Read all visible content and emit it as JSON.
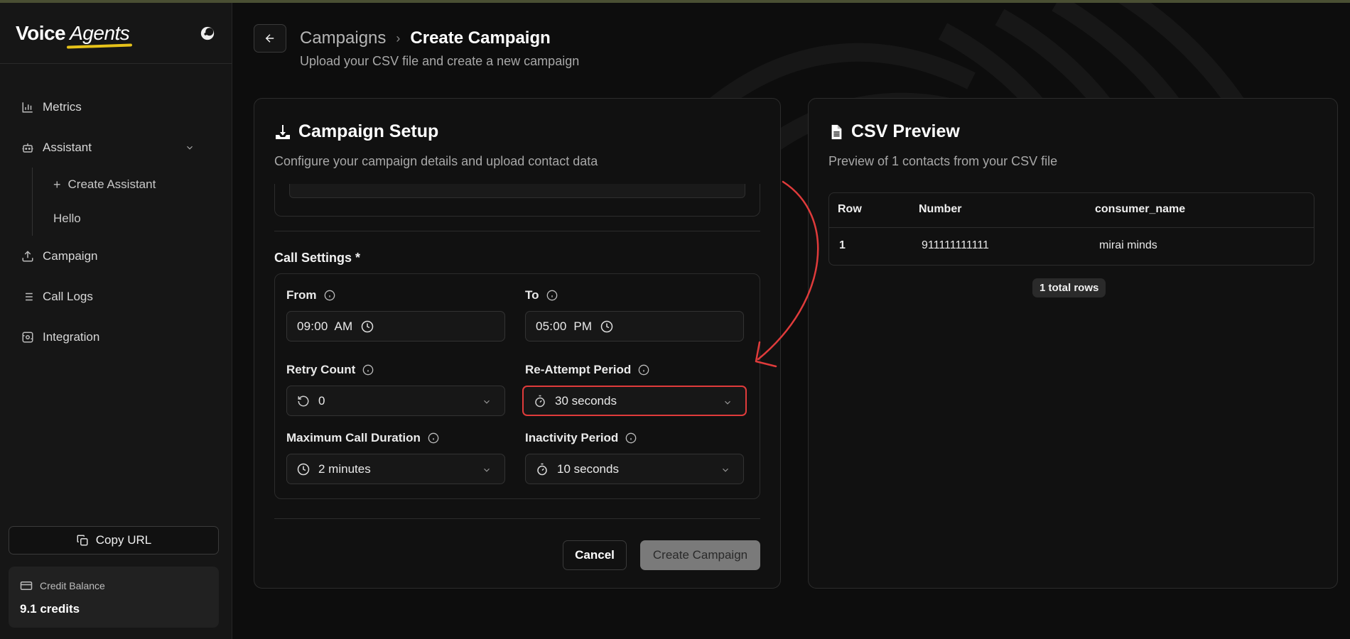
{
  "app": {
    "brand_main": "Voice",
    "brand_accent": "Agents"
  },
  "sidebar": {
    "items": [
      {
        "label": "Metrics",
        "icon": "bar-chart-icon"
      },
      {
        "label": "Assistant",
        "icon": "bot-icon"
      },
      {
        "label": "Campaign",
        "icon": "upload-icon"
      },
      {
        "label": "Call Logs",
        "icon": "list-icon"
      },
      {
        "label": "Integration",
        "icon": "integration-icon"
      }
    ],
    "assistant_sub": [
      {
        "label": "Create Assistant"
      },
      {
        "label": "Hello"
      }
    ],
    "copy_url_label": "Copy URL",
    "credit_label": "Credit Balance",
    "credit_value": "9.1 credits"
  },
  "header": {
    "breadcrumb_parent": "Campaigns",
    "breadcrumb_current": "Create Campaign",
    "subtitle": "Upload your CSV file and create a new campaign"
  },
  "setup": {
    "title": "Campaign Setup",
    "description": "Configure your campaign details and upload contact data",
    "section_label": "Call Settings *",
    "from": {
      "label": "From",
      "value": "09:00  AM"
    },
    "to": {
      "label": "To",
      "value": "05:00  PM"
    },
    "retry": {
      "label": "Retry Count",
      "value": "0"
    },
    "reattempt": {
      "label": "Re-Attempt Period",
      "value": "30 seconds"
    },
    "max_duration": {
      "label": "Maximum Call Duration",
      "value": "2 minutes"
    },
    "inactivity": {
      "label": "Inactivity Period",
      "value": "10 seconds"
    },
    "cancel_label": "Cancel",
    "create_label": "Create Campaign"
  },
  "csv": {
    "title": "CSV Preview",
    "description": "Preview of 1 contacts from your CSV file",
    "columns": [
      "Row",
      "Number",
      "consumer_name"
    ],
    "rows": [
      [
        "1",
        "911111111111",
        "mirai minds"
      ]
    ],
    "total_label": "1 total rows"
  },
  "colors": {
    "background": "#0d0d0d",
    "highlight": "#e03b3b",
    "brand_underline": "#e6c21a"
  }
}
